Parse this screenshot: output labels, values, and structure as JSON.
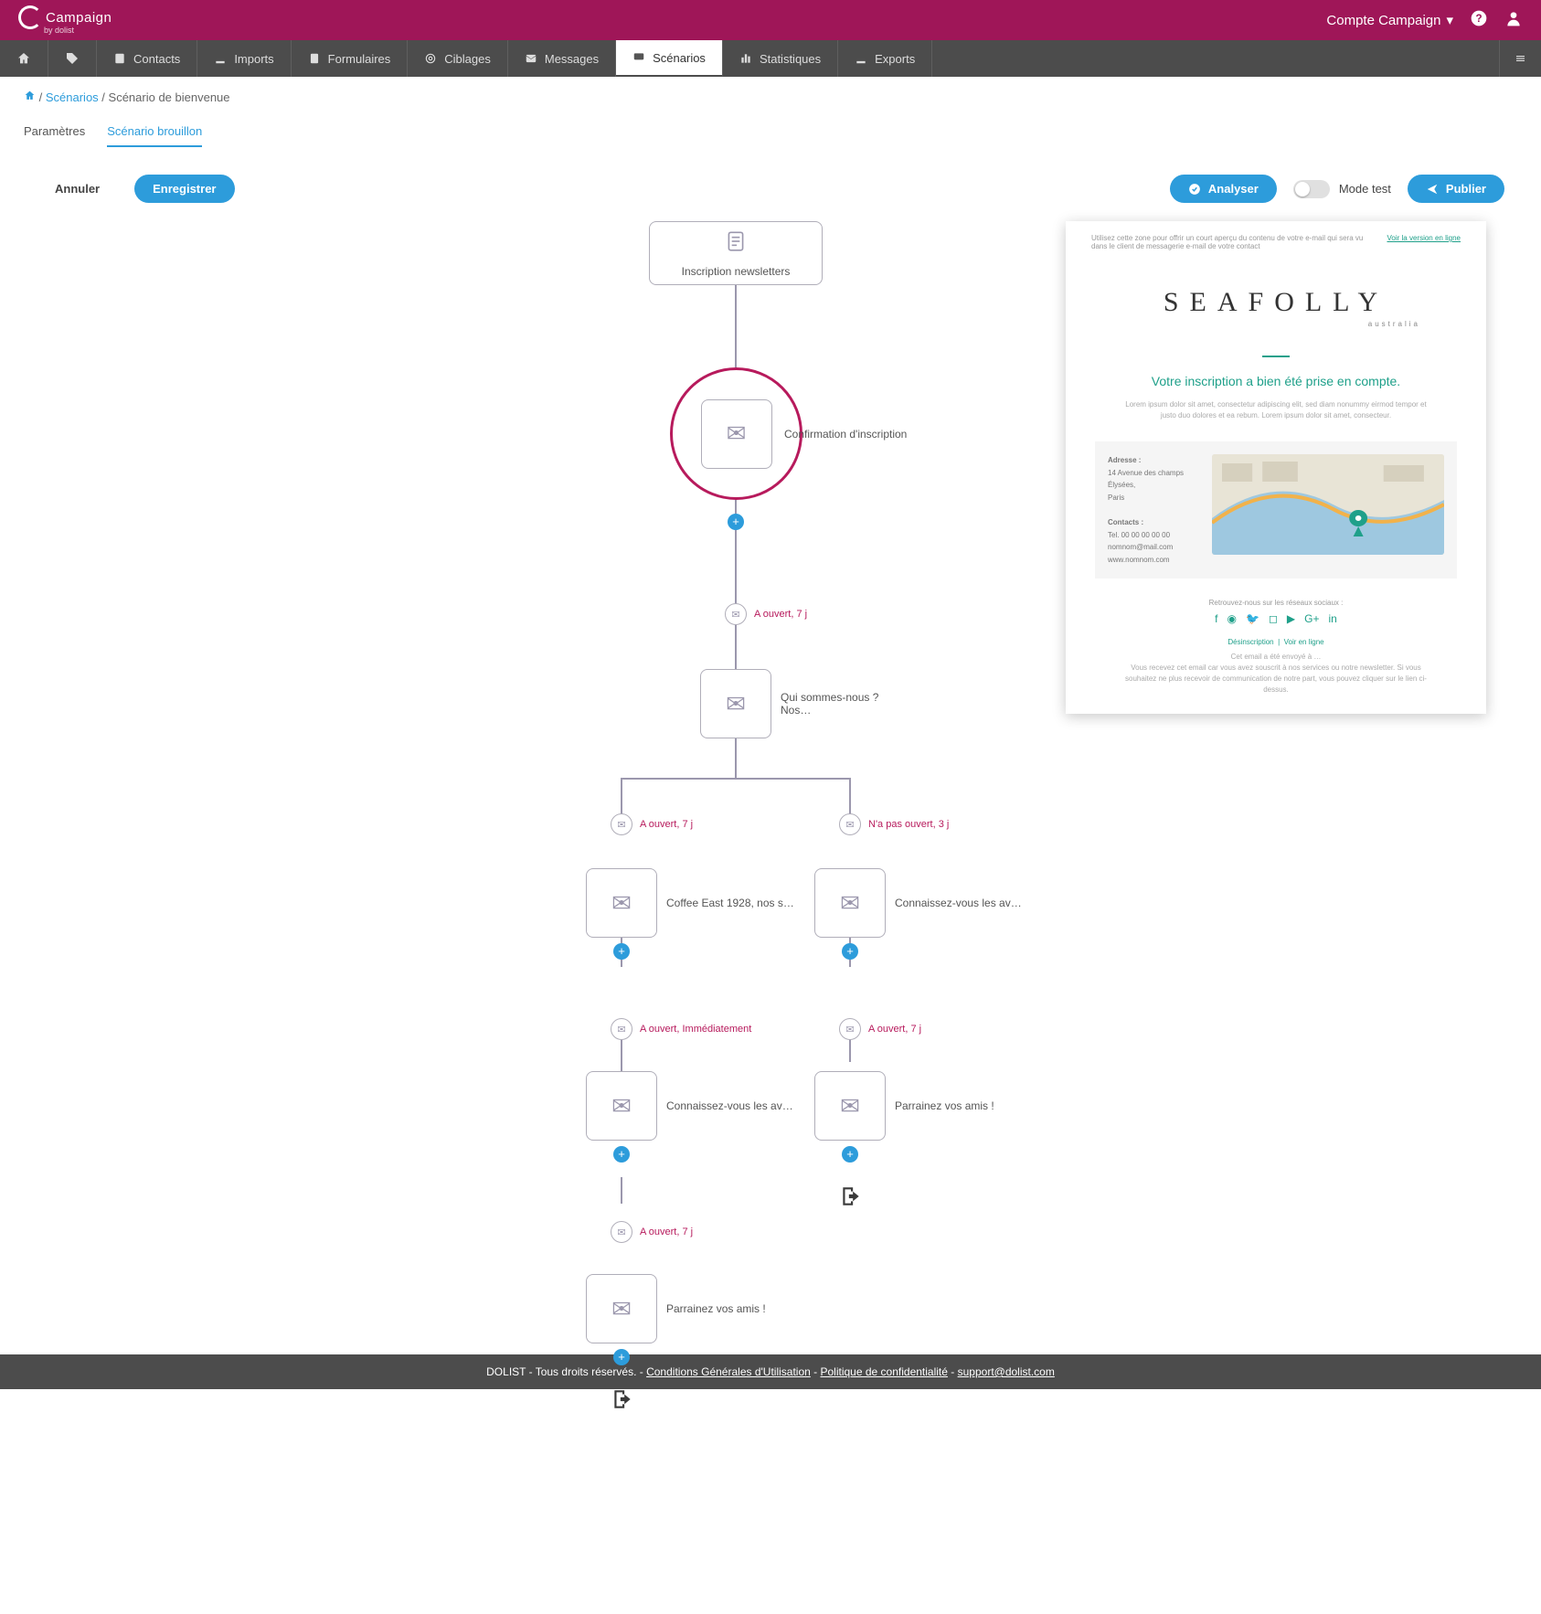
{
  "header": {
    "brand": "Campaign",
    "brand_sub": "by dolist",
    "account": "Compte Campaign"
  },
  "nav": {
    "items": [
      "Contacts",
      "Imports",
      "Formulaires",
      "Ciblages",
      "Messages",
      "Scénarios",
      "Statistiques",
      "Exports"
    ],
    "active_index": 5
  },
  "breadcrumb": {
    "sep": " / ",
    "root": "Scénarios",
    "current": "Scénario de bienvenue"
  },
  "tabs": {
    "items": [
      "Paramètres",
      "Scénario brouillon"
    ],
    "active_index": 1
  },
  "actions": {
    "cancel": "Annuler",
    "save": "Enregistrer",
    "analyze": "Analyser",
    "mode_test": "Mode test",
    "publish": "Publier"
  },
  "flow": {
    "start": "Inscription newsletters",
    "confirm": "Confirmation d'inscription",
    "cond1": "A ouvert,  7 j",
    "who": "Qui sommes-nous ? Nos…",
    "cond_left": "A ouvert,  7 j",
    "cond_right": "N'a pas ouvert,  3 j",
    "left1": "Coffee East 1928, nos s…",
    "right1": "Connaissez-vous les av…",
    "cond_left2": "A ouvert,  Immédiatement",
    "cond_right2": "A ouvert,  7 j",
    "left2": "Connaissez-vous les av…",
    "right2": "Parrainez vos amis !",
    "cond_left3": "A ouvert,  7 j",
    "left3": "Parrainez vos amis !"
  },
  "preview": {
    "note": "Utilisez cette zone pour offrir un court aperçu du contenu de votre e-mail qui sera vu dans le client de messagerie e-mail de votre contact",
    "view_online": "Voir la version en ligne",
    "brand": "SEAFOLLY",
    "brand_sub": "australia",
    "headline": "Votre inscription a bien été prise en compte.",
    "lorem": "Lorem ipsum dolor sit amet, consectetur adipiscing elit, sed diam nonummy eirmod tempor et justo duo dolores et ea rebum. Lorem ipsum dolor sit amet, consecteur.",
    "addr_title": "Adresse :",
    "addr": "14 Avenue des champs Élysées,\nParis",
    "contact_title": "Contacts :",
    "phone": "Tel. 00 00 00 00 00",
    "email": "nomnom@mail.com",
    "site": "www.nomnom.com",
    "social": "Retrouvez-nous sur les réseaux sociaux :",
    "unsub": "Désinscription",
    "view": "Voir en ligne",
    "disclaim1": "Cet email a été envoyé à …",
    "disclaim2": "Vous recevez cet email car vous avez souscrit à nos services ou notre newsletter. Si vous souhaitez ne plus recevoir de communication de notre part, vous pouvez cliquer sur le lien ci-dessus."
  },
  "footer": {
    "copy": "DOLIST - Tous droits réservés. - ",
    "cgu": "Conditions Générales d'Utilisation",
    "sep": " - ",
    "privacy": "Politique de confidentialité",
    "support": "support@dolist.com"
  }
}
